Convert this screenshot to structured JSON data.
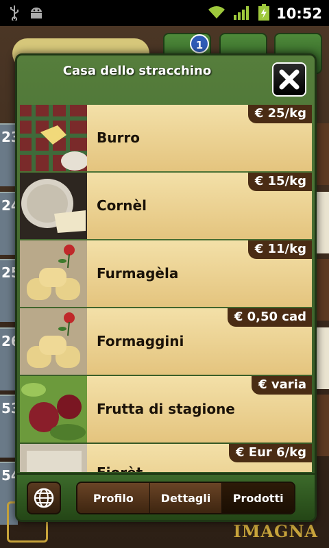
{
  "status_bar": {
    "time": "10:52"
  },
  "background": {
    "notification_count": "1",
    "row_numbers": [
      "23",
      "24",
      "25",
      "26",
      "53",
      "54"
    ],
    "brand": "IMAGNA"
  },
  "dialog": {
    "title": "Casa dello stracchino",
    "products": [
      {
        "name": "Burro",
        "price": "€ 25/kg"
      },
      {
        "name": "Cornèl",
        "price": "€ 15/kg"
      },
      {
        "name": "Furmagèla",
        "price": "€ 11/kg"
      },
      {
        "name": "Formaggini",
        "price": "€ 0,50 cad"
      },
      {
        "name": "Frutta di stagione",
        "price": "€ varia"
      },
      {
        "name": "Fiorèt",
        "price": "€ Eur 6/kg"
      }
    ],
    "tabs": [
      {
        "label": "Profilo"
      },
      {
        "label": "Dettagli"
      },
      {
        "label": "Prodotti",
        "active": true
      }
    ]
  }
}
